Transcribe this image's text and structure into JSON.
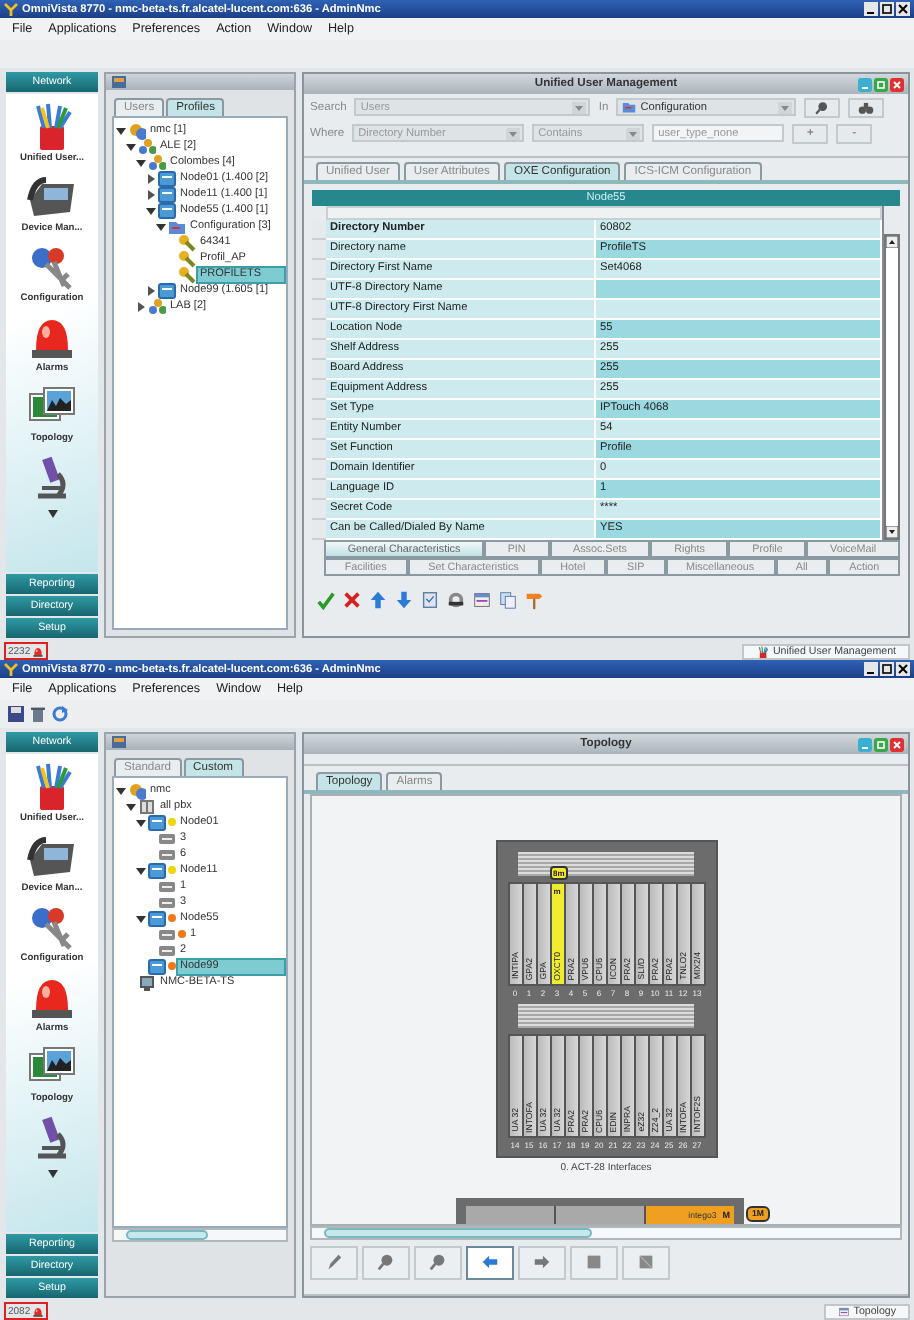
{
  "windows": [
    {
      "kind": "users",
      "title": "OmniVista 8770 - nmc-beta-ts.fr.alcatel-lucent.com:636 - AdminNmc",
      "menu": [
        "File",
        "Applications",
        "Preferences",
        "Action",
        "Window",
        "Help"
      ],
      "nav": {
        "header": "Network",
        "items": [
          "Unified User...",
          "Device Man...",
          "Configuration",
          "Alarms",
          "Topology"
        ],
        "buttons": [
          "Reporting",
          "Directory",
          "Setup"
        ]
      },
      "tree_tabs": [
        {
          "label": "Users",
          "selected": false
        },
        {
          "label": "Profiles",
          "selected": true
        }
      ],
      "tree": [
        {
          "label": "nmc [1]",
          "kind": "network",
          "expanded": true,
          "selected": false,
          "children": [
            {
              "label": "ALE [2]",
              "kind": "group",
              "expanded": true,
              "selected": false,
              "children": [
                {
                  "label": "Colombes [4]",
                  "kind": "group",
                  "expanded": true,
                  "selected": false,
                  "children": [
                    {
                      "label": "Node01 (1.400 [2]",
                      "kind": "node",
                      "expanded": false,
                      "selected": false
                    },
                    {
                      "label": "Node11 (1.400 [1]",
                      "kind": "node",
                      "expanded": false,
                      "selected": false
                    },
                    {
                      "label": "Node55 (1.400 [1]",
                      "kind": "node",
                      "expanded": true,
                      "selected": false,
                      "children": [
                        {
                          "label": "Configuration [3]",
                          "kind": "folder",
                          "expanded": true,
                          "selected": false,
                          "children": [
                            {
                              "label": "64341",
                              "kind": "profile",
                              "selected": false
                            },
                            {
                              "label": "Profil_AP",
                              "kind": "profile",
                              "selected": false
                            },
                            {
                              "label": "PROFILETS",
                              "kind": "profile",
                              "selected": true
                            }
                          ]
                        }
                      ]
                    },
                    {
                      "label": "Node99 (1.605 [1]",
                      "kind": "node",
                      "expanded": false,
                      "selected": false
                    }
                  ]
                },
                {
                  "label": "LAB [2]",
                  "kind": "group",
                  "expanded": false,
                  "selected": false
                }
              ]
            }
          ]
        }
      ],
      "panel": {
        "title": "Unified User Management",
        "search": {
          "label": "Search",
          "scope": "Users",
          "in_label": "In",
          "location": "Configuration"
        },
        "where": {
          "label": "Where",
          "field": "Directory Number",
          "operator": "Contains",
          "placeholder": "user_type_none",
          "add": "+",
          "remove": "-"
        },
        "tabs": [
          {
            "label": "Unified User",
            "selected": false
          },
          {
            "label": "User Attributes",
            "selected": false
          },
          {
            "label": "OXE Configuration",
            "selected": true
          },
          {
            "label": "ICS-ICM Configuration",
            "selected": false
          }
        ],
        "group": "Node55",
        "rows": [
          {
            "name": "Directory Number",
            "value": "60802"
          },
          {
            "name": "Directory name",
            "value": "ProfileTS"
          },
          {
            "name": "Directory First Name",
            "value": "Set4068"
          },
          {
            "name": "UTF-8 Directory Name",
            "value": ""
          },
          {
            "name": "UTF-8 Directory First Name",
            "value": ""
          },
          {
            "name": "Location Node",
            "value": "55"
          },
          {
            "name": "Shelf Address",
            "value": "255"
          },
          {
            "name": "Board Address",
            "value": "255"
          },
          {
            "name": "Equipment Address",
            "value": "255"
          },
          {
            "name": "Set Type",
            "value": "IPTouch 4068"
          },
          {
            "name": "Entity Number",
            "value": "54"
          },
          {
            "name": "Set Function",
            "value": "Profile"
          },
          {
            "name": "Domain Identifier",
            "value": "0"
          },
          {
            "name": "Language ID",
            "value": "1"
          },
          {
            "name": "Secret Code",
            "value": "****"
          },
          {
            "name": "Can be Called/Dialed By Name",
            "value": "YES"
          }
        ],
        "sub_tab_rows": [
          [
            {
              "label": "General Characteristics",
              "selected": true
            },
            {
              "label": "PIN",
              "selected": false
            },
            {
              "label": "Assoc.Sets",
              "selected": false
            },
            {
              "label": "Rights",
              "selected": false
            },
            {
              "label": "Profile",
              "selected": false
            },
            {
              "label": "VoiceMail",
              "selected": false
            }
          ],
          [
            {
              "label": "Facilities",
              "selected": false
            },
            {
              "label": "Set Characteristics",
              "selected": false
            },
            {
              "label": "Hotel",
              "selected": false
            },
            {
              "label": "SIP",
              "selected": false
            },
            {
              "label": "Miscellaneous",
              "selected": false
            },
            {
              "label": "All",
              "selected": false
            },
            {
              "label": "Action",
              "selected": false
            }
          ]
        ]
      },
      "status": {
        "alarm_count": "2232",
        "taskbar": "Unified User Management"
      }
    },
    {
      "kind": "topology",
      "title": "OmniVista 8770 - nmc-beta-ts.fr.alcatel-lucent.com:636 - AdminNmc",
      "menu": [
        "File",
        "Applications",
        "Preferences",
        "Window",
        "Help"
      ],
      "nav": {
        "header": "Network",
        "items": [
          "Unified User...",
          "Device Man...",
          "Configuration",
          "Alarms",
          "Topology"
        ],
        "buttons": [
          "Reporting",
          "Directory",
          "Setup"
        ]
      },
      "tree_tabs": [
        {
          "label": "Standard",
          "selected": false
        },
        {
          "label": "Custom",
          "selected": true
        }
      ],
      "tree": [
        {
          "label": "nmc",
          "kind": "network",
          "expanded": true,
          "selected": false,
          "children": [
            {
              "label": "all pbx",
              "kind": "pbx",
              "expanded": true,
              "selected": false,
              "children": [
                {
                  "label": "Node01",
                  "kind": "node",
                  "color": "#f2d600",
                  "expanded": true,
                  "selected": false,
                  "children": [
                    {
                      "label": "3",
                      "kind": "shelf",
                      "selected": false
                    },
                    {
                      "label": "6",
                      "kind": "shelf",
                      "selected": false
                    }
                  ]
                },
                {
                  "label": "Node11",
                  "kind": "node",
                  "color": "#f2d600",
                  "expanded": true,
                  "selected": false,
                  "children": [
                    {
                      "label": "1",
                      "kind": "shelf",
                      "selected": false
                    },
                    {
                      "label": "3",
                      "kind": "shelf",
                      "selected": false
                    }
                  ]
                },
                {
                  "label": "Node55",
                  "kind": "node",
                  "color": "#f07818",
                  "expanded": true,
                  "selected": false,
                  "children": [
                    {
                      "label": "1",
                      "kind": "shelf",
                      "color": "#f07818",
                      "selected": false
                    },
                    {
                      "label": "2",
                      "kind": "shelf",
                      "selected": false
                    }
                  ]
                },
                {
                  "label": "Node99",
                  "kind": "node",
                  "color": "#f07818",
                  "selected": true
                }
              ]
            },
            {
              "label": "NMC-BETA-TS",
              "kind": "server",
              "selected": false
            }
          ]
        }
      ],
      "panel": {
        "title": "Topology",
        "tabs": [
          {
            "label": "Topology",
            "selected": true
          },
          {
            "label": "Alarms",
            "selected": false
          }
        ],
        "rack": {
          "shelves": [
            {
              "slots": [
                {
                  "label": "INTIPA",
                  "number": "0",
                  "highlighted": false
                },
                {
                  "label": "GPA2",
                  "number": "1",
                  "highlighted": false
                },
                {
                  "label": "GPA",
                  "number": "2",
                  "highlighted": false
                },
                {
                  "label": "OXCT0",
                  "number": "3",
                  "highlighted": true,
                  "tag": "m",
                  "badge": "8m"
                },
                {
                  "label": "PRA2",
                  "number": "4",
                  "highlighted": false
                },
                {
                  "label": "VPU6",
                  "number": "5",
                  "highlighted": false
                },
                {
                  "label": "CPU6",
                  "number": "6",
                  "highlighted": false
                },
                {
                  "label": "ICON",
                  "number": "7",
                  "highlighted": false
                },
                {
                  "label": "PRA2",
                  "number": "8",
                  "highlighted": false
                },
                {
                  "label": "SLI/D",
                  "number": "9",
                  "highlighted": false
                },
                {
                  "label": "PRA2",
                  "number": "10",
                  "highlighted": false
                },
                {
                  "label": "PRA2",
                  "number": "11",
                  "highlighted": false
                },
                {
                  "label": "TNLO2",
                  "number": "12",
                  "highlighted": false
                },
                {
                  "label": "MIX2/4",
                  "number": "13",
                  "highlighted": false
                }
              ]
            },
            {
              "slots": [
                {
                  "label": "UA 32",
                  "number": "14",
                  "highlighted": false
                },
                {
                  "label": "INTOFA",
                  "number": "15",
                  "highlighted": false
                },
                {
                  "label": "UA 32",
                  "number": "16",
                  "highlighted": false
                },
                {
                  "label": "UA 32",
                  "number": "17",
                  "highlighted": false
                },
                {
                  "label": "PRA2",
                  "number": "18",
                  "highlighted": false
                },
                {
                  "label": "PRA2",
                  "number": "19",
                  "highlighted": false
                },
                {
                  "label": "CPU6",
                  "number": "20",
                  "highlighted": false
                },
                {
                  "label": "EDIN",
                  "number": "21",
                  "highlighted": false
                },
                {
                  "label": "INPRA",
                  "number": "22",
                  "highlighted": false
                },
                {
                  "label": "eZ32",
                  "number": "23",
                  "highlighted": false
                },
                {
                  "label": "Z24_2",
                  "number": "24",
                  "highlighted": false
                },
                {
                  "label": "UA 32",
                  "number": "25",
                  "highlighted": false
                },
                {
                  "label": "INTOFA",
                  "number": "26",
                  "highlighted": false
                },
                {
                  "label": "INTOF2S",
                  "number": "27",
                  "highlighted": false
                }
              ]
            }
          ],
          "caption": "0. ACT-28 Interfaces"
        },
        "module": {
          "label": "intego3",
          "flag": "M",
          "badge": "1M"
        },
        "tools": [
          {
            "selected": false
          },
          {
            "selected": false
          },
          {
            "selected": false
          },
          {
            "selected": true
          },
          {
            "selected": false
          },
          {
            "selected": false
          },
          {
            "selected": false
          }
        ]
      },
      "status": {
        "alarm_count": "2082",
        "taskbar": "Topology"
      }
    }
  ]
}
